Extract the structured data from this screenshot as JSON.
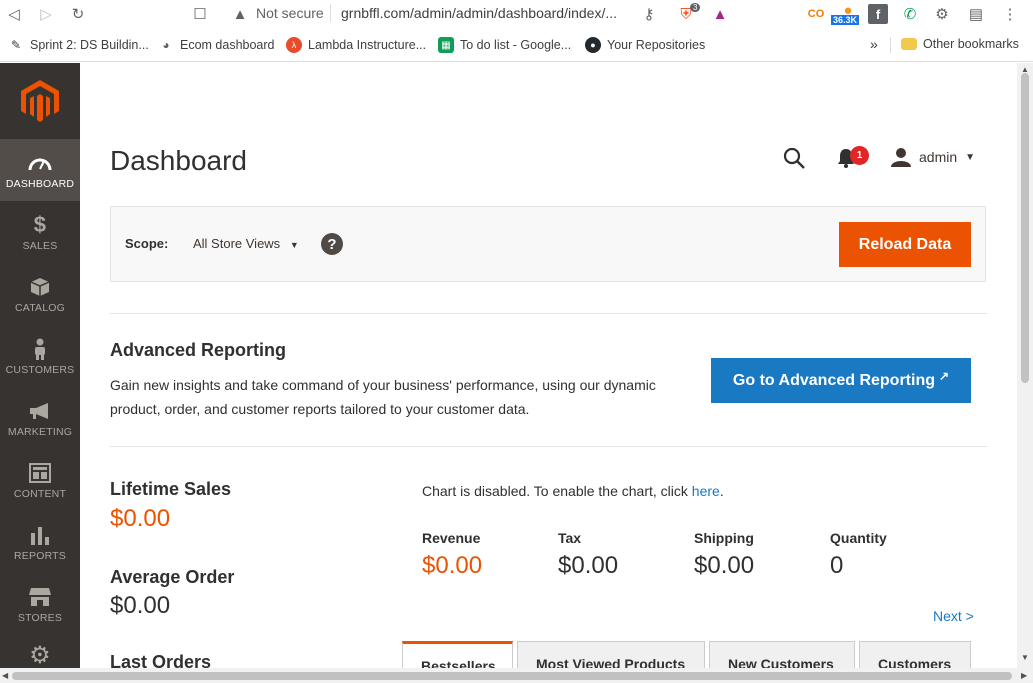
{
  "browser": {
    "security_label": "Not secure",
    "url": "grnbffl.com/admin/admin/dashboard/index/...",
    "brave_count": "3",
    "ext_badge": "36.3K",
    "bookmarks": [
      {
        "label": "Sprint 2: DS Buildin...",
        "icon": "pencil-icon"
      },
      {
        "label": "Ecom dashboard",
        "icon": "globe-icon"
      },
      {
        "label": "Lambda Instructure...",
        "icon": "lambda-icon"
      },
      {
        "label": "To do list - Google...",
        "icon": "sheets-icon"
      },
      {
        "label": "Your Repositories",
        "icon": "github-icon"
      }
    ],
    "overflow": "»",
    "other_bookmarks": "Other bookmarks"
  },
  "sidebar": {
    "items": [
      {
        "label": "DASHBOARD",
        "icon": "dashboard-icon",
        "active": true
      },
      {
        "label": "SALES",
        "icon": "dollar-icon"
      },
      {
        "label": "CATALOG",
        "icon": "box-icon"
      },
      {
        "label": "CUSTOMERS",
        "icon": "person-icon"
      },
      {
        "label": "MARKETING",
        "icon": "megaphone-icon"
      },
      {
        "label": "CONTENT",
        "icon": "layout-icon"
      },
      {
        "label": "REPORTS",
        "icon": "bar-chart-icon"
      },
      {
        "label": "STORES",
        "icon": "store-icon"
      }
    ]
  },
  "header": {
    "title": "Dashboard",
    "notification_count": "1",
    "user": "admin"
  },
  "scope": {
    "label": "Scope:",
    "value": "All Store Views",
    "help": "?",
    "reload": "Reload Data"
  },
  "advanced": {
    "title": "Advanced Reporting",
    "text": "Gain new insights and take command of your business' performance, using our dynamic product, order, and customer reports tailored to your customer data.",
    "button": "Go to Advanced Reporting"
  },
  "kpis": {
    "lifetime_label": "Lifetime Sales",
    "lifetime_value": "$0.00",
    "average_label": "Average Order",
    "average_value": "$0.00",
    "last_orders": "Last Orders"
  },
  "chart": {
    "message": "Chart is disabled. To enable the chart, click ",
    "link": "here",
    "period": "."
  },
  "totals": [
    {
      "label": "Revenue",
      "value": "$0.00"
    },
    {
      "label": "Tax",
      "value": "$0.00"
    },
    {
      "label": "Shipping",
      "value": "$0.00"
    },
    {
      "label": "Quantity",
      "value": "0"
    }
  ],
  "next": "Next >",
  "tabs": [
    "Bestsellers",
    "Most Viewed Products",
    "New Customers",
    "Customers"
  ],
  "colors": {
    "accent": "#eb5202",
    "link": "#1979c3",
    "sidebar": "#373330"
  }
}
